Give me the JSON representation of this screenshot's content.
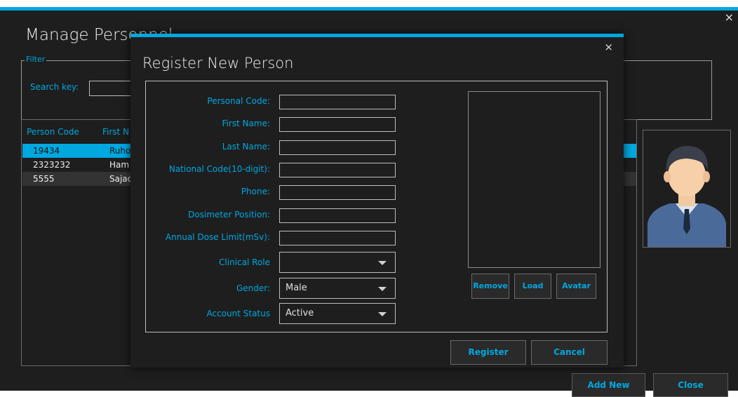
{
  "window": {
    "title": "Manage Personnel",
    "close_glyph": "×"
  },
  "filter": {
    "legend": "Filter",
    "search_label": "Search key:",
    "search_value": ""
  },
  "grid": {
    "columns": [
      "Person Code",
      "First N"
    ],
    "rows": [
      {
        "code": "19434",
        "first": "Ruho",
        "selected": true
      },
      {
        "code": "2323232",
        "first": "Ham",
        "selected": false
      },
      {
        "code": "5555",
        "first": "Sajad",
        "selected": false
      }
    ]
  },
  "main_buttons": {
    "add_new": "Add New",
    "close": "Close"
  },
  "dialog": {
    "title": "Register New Person",
    "close_glyph": "×",
    "fields": {
      "personal_code": {
        "label": "Personal Code:",
        "value": ""
      },
      "first_name": {
        "label": "First Name:",
        "value": ""
      },
      "last_name": {
        "label": "Last Name:",
        "value": ""
      },
      "national_code": {
        "label": "National Code(10-digit):",
        "value": ""
      },
      "phone": {
        "label": "Phone:",
        "value": ""
      },
      "dosimeter_position": {
        "label": "Dosimeter Position:",
        "value": ""
      },
      "annual_dose_limit": {
        "label": "Annual Dose Limit(mSv):",
        "value": ""
      },
      "clinical_role": {
        "label": "Clinical Role",
        "value": ""
      },
      "gender": {
        "label": "Gender:",
        "value": "Male"
      },
      "account_status": {
        "label": "Account Status",
        "value": "Active"
      }
    },
    "photo_buttons": {
      "remove": "Remove",
      "load": "Load",
      "avatar": "Avatar"
    },
    "register": "Register",
    "cancel": "Cancel"
  },
  "colors": {
    "accent": "#00a8e0",
    "background": "#1e1e1e"
  }
}
